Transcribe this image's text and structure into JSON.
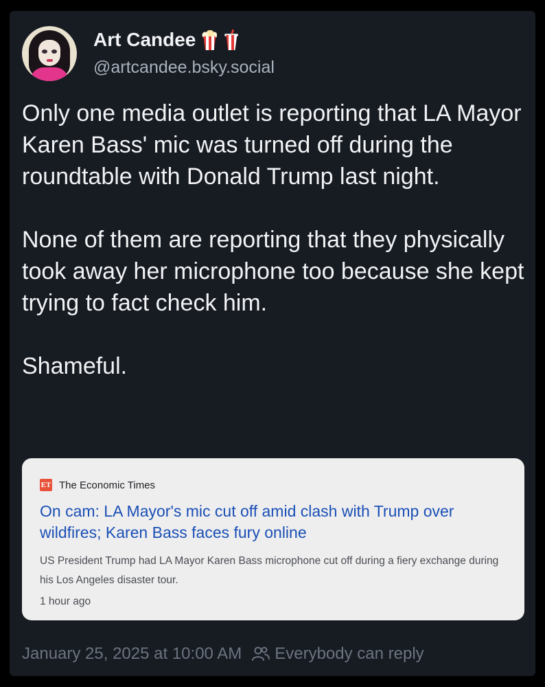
{
  "author": {
    "display_name": "Art Candee",
    "handle": "@artcandee.bsky.social",
    "avatar_icon": "avatar-illustration",
    "name_emojis": [
      "popcorn-icon",
      "cup-with-straw-icon"
    ]
  },
  "post": {
    "paragraphs": [
      "Only one media outlet is reporting that LA Mayor Karen Bass' mic was turned off during the roundtable with Donald Trump last night.",
      "None of them are reporting that they physically took away her microphone too because she kept trying to fact check him.",
      "Shameful."
    ]
  },
  "link_card": {
    "source_logo_text": "ET",
    "source_name": "The Economic Times",
    "title": "On cam: LA Mayor's mic cut off amid clash with Trump over wildfires; Karen Bass faces fury online",
    "description": "US President Trump had LA Mayor Karen Bass microphone cut off during a fiery exchange during his Los Angeles disaster tour.",
    "time": "1 hour ago"
  },
  "footer": {
    "timestamp": "January 25, 2025 at 10:00 AM",
    "reply_setting": "Everybody can reply",
    "reply_icon": "people-icon"
  },
  "colors": {
    "background": "#171b22",
    "text": "#f1f3f5",
    "muted": "#a9b2bd",
    "link": "#1a4fb5",
    "card_bg": "#eeeeef"
  }
}
